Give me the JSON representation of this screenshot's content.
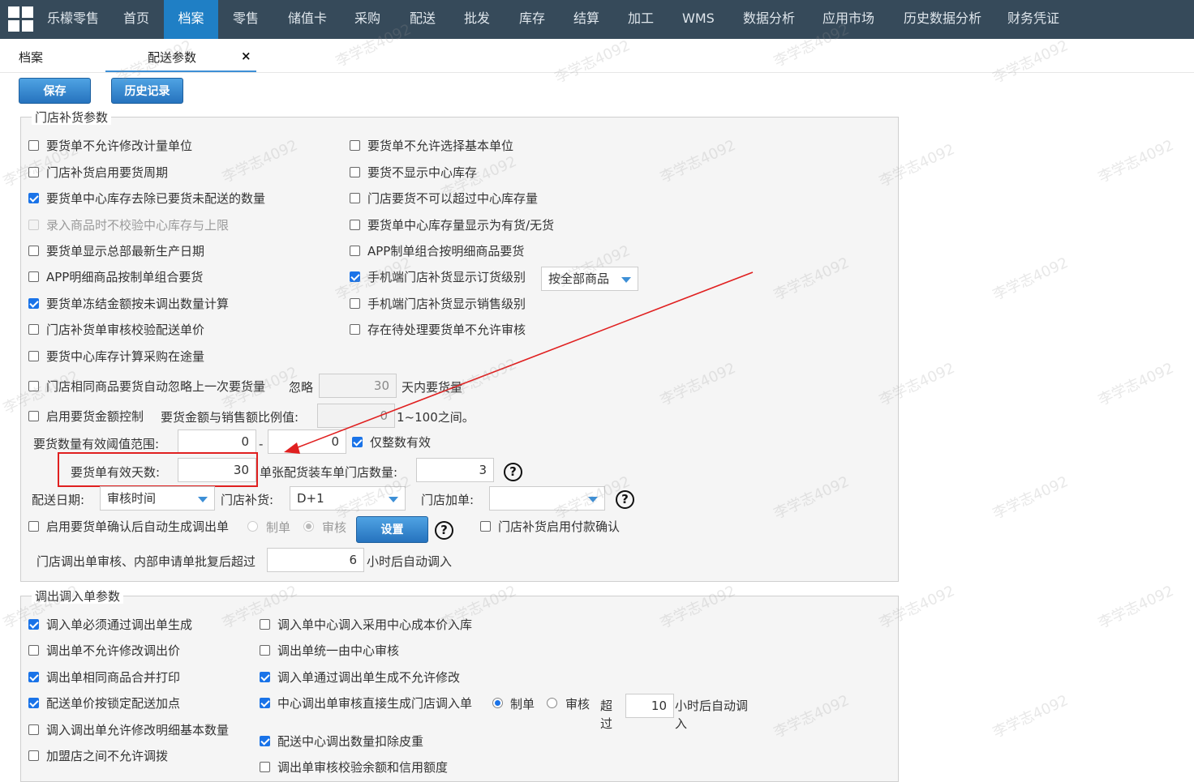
{
  "nav": {
    "brand": "乐檬零售",
    "items": [
      "首页",
      "档案",
      "零售",
      "储值卡",
      "采购",
      "配送",
      "批发",
      "库存",
      "结算",
      "加工",
      "WMS",
      "数据分析",
      "应用市场",
      "历史数据分析",
      "财务凭证"
    ],
    "active": "档案"
  },
  "tabs": {
    "archive": "档案",
    "current": "配送参数",
    "close": "×"
  },
  "toolbar": {
    "save": "保存",
    "history": "历史记录"
  },
  "store_group": {
    "title": "门店补货参数",
    "left_options": [
      {
        "label": "要货单不允许修改计量单位",
        "checked": false
      },
      {
        "label": "门店补货启用要货周期",
        "checked": false
      },
      {
        "label": "要货单中心库存去除已要货未配送的数量",
        "checked": true
      },
      {
        "label": "录入商品时不校验中心库存与上限",
        "checked": false,
        "disabled": true
      },
      {
        "label": "要货单显示总部最新生产日期",
        "checked": false
      },
      {
        "label": "APP明细商品按制单组合要货",
        "checked": false
      },
      {
        "label": "要货单冻结金额按未调出数量计算",
        "checked": true
      },
      {
        "label": "门店补货单审核校验配送单价",
        "checked": false
      },
      {
        "label": "要货中心库存计算采购在途量",
        "checked": false
      }
    ],
    "right_options": [
      {
        "label": "要货单不允许选择基本单位",
        "checked": false
      },
      {
        "label": "要货不显示中心库存",
        "checked": false
      },
      {
        "label": "门店要货不可以超过中心库存量",
        "checked": false
      },
      {
        "label": "要货单中心库存量显示为有货/无货",
        "checked": false
      },
      {
        "label": "APP制单组合按明细商品要货",
        "checked": false
      },
      {
        "label": "手机端门店补货显示订货级别",
        "checked": true
      },
      {
        "label": "手机端门店补货显示销售级别",
        "checked": false
      },
      {
        "label": "存在待处理要货单不允许审核",
        "checked": false
      }
    ],
    "order_level_select": "按全部商品",
    "ignore_row": {
      "label": "门店相同商品要货自动忽略上一次要货量",
      "checked": false,
      "ignore": "忽略",
      "days": "30",
      "suffix": "天内要货量"
    },
    "amount_row": {
      "label": "启用要货金额控制",
      "checked": false,
      "ratio_label": "要货金额与销售额比例值:",
      "ratio": "0",
      "suffix": "1~100之间。"
    },
    "threshold": {
      "label": "要货数量有效阈值范围:",
      "min": "0",
      "sep": "-",
      "max": "0",
      "integer_label": "仅整数有效",
      "integer_checked": true
    },
    "valid_days": {
      "label": "要货单有效天数:",
      "value": "30"
    },
    "truck": {
      "label": "单张配货装车单门店数量:",
      "value": "3"
    },
    "delivery": {
      "date_label": "配送日期:",
      "date_value": "审核时间",
      "replenish_label": "门店补货:",
      "replenish_value": "D+1",
      "add_label": "门店加单:",
      "add_value": ""
    },
    "auto_transfer": {
      "label": "启用要货单确认后自动生成调出单",
      "checked": false,
      "opt1": "制单",
      "opt2": "审核",
      "button": "设置",
      "pay_label": "门店补货启用付款确认",
      "pay_checked": false
    },
    "auto_in": {
      "label": "门店调出单审核、内部申请单批复后超过",
      "hours": "6",
      "suffix": "小时后自动调入"
    }
  },
  "transfer_group": {
    "title": "调出调入单参数",
    "left_options": [
      {
        "label": "调入单必须通过调出单生成",
        "checked": true
      },
      {
        "label": "调出单不允许修改调出价",
        "checked": false
      },
      {
        "label": "调出单相同商品合并打印",
        "checked": true
      },
      {
        "label": "配送单价按锁定配送加点",
        "checked": true
      },
      {
        "label": "调入调出单允许修改明细基本数量",
        "checked": false
      },
      {
        "label": "加盟店之间不允许调拨",
        "checked": false
      }
    ],
    "right_options": [
      {
        "label": "调入单中心调入采用中心成本价入库",
        "checked": false
      },
      {
        "label": "调出单统一由中心审核",
        "checked": false
      },
      {
        "label": "调入单通过调出单生成不允许修改",
        "checked": true
      },
      {
        "label": "中心调出单审核直接生成门店调入单",
        "checked": true
      },
      {
        "label": "配送中心调出数量扣除皮重",
        "checked": true
      },
      {
        "label": "调出单审核校验余额和信用额度",
        "checked": false
      }
    ],
    "center_radio": {
      "opt1": "制单",
      "opt1_on": true,
      "opt2": "审核",
      "opt2_on": false,
      "over1": "超",
      "over2": "过",
      "hours": "10",
      "suffix1": "小时后自动调",
      "suffix2": "入"
    }
  },
  "watermark": "李学志4092",
  "colors": {
    "nav_bg": "#364a5a",
    "nav_active": "#1f7fc5",
    "highlight": "#e02020",
    "arrow": "#e02020"
  }
}
